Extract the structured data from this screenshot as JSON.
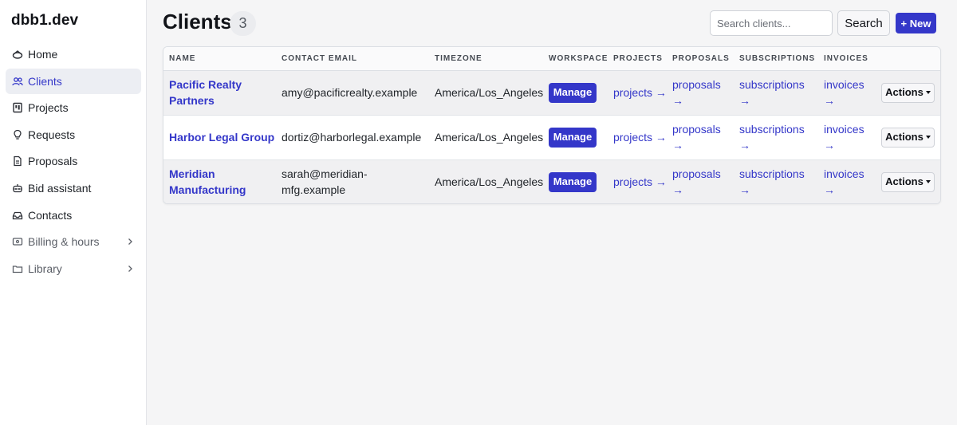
{
  "brand": "dbb1.dev",
  "sidebar": {
    "items": [
      {
        "label": "Home",
        "icon": "home-icon"
      },
      {
        "label": "Clients",
        "icon": "users-icon",
        "active": true
      },
      {
        "label": "Projects",
        "icon": "projects-icon"
      },
      {
        "label": "Requests",
        "icon": "lightbulb-icon"
      },
      {
        "label": "Proposals",
        "icon": "document-icon"
      },
      {
        "label": "Bid assistant",
        "icon": "robot-icon"
      },
      {
        "label": "Contacts",
        "icon": "inbox-icon"
      },
      {
        "label": "Billing & hours",
        "icon": "billing-icon",
        "expandable": true
      },
      {
        "label": "Library",
        "icon": "folder-icon",
        "expandable": true
      }
    ]
  },
  "header": {
    "title": "Clients",
    "count": "3",
    "search_placeholder": "Search clients...",
    "search_label": "Search",
    "new_label": "+ New"
  },
  "table": {
    "columns": [
      "Name",
      "Contact email",
      "Timezone",
      "Workspace",
      "Projects",
      "Proposals",
      "Subscriptions",
      "Invoices",
      ""
    ],
    "rows": [
      {
        "name": "Pacific Realty Partners",
        "email": "amy@pacificrealty.example",
        "timezone": "America/Los_Angeles",
        "workspace": "Manage",
        "projects": "projects →",
        "proposals": "proposals →",
        "subscriptions": "subscriptions →",
        "invoices": "invoices →",
        "actions": "Actions"
      },
      {
        "name": "Harbor Legal Group",
        "email": "dortiz@harborlegal.example",
        "timezone": "America/Los_Angeles",
        "workspace": "Manage",
        "projects": "projects →",
        "proposals": "proposals →",
        "subscriptions": "subscriptions →",
        "invoices": "invoices →",
        "actions": "Actions"
      },
      {
        "name": "Meridian Manufacturing",
        "email": "sarah@meridian-mfg.example",
        "timezone": "America/Los_Angeles",
        "workspace": "Manage",
        "projects": "projects →",
        "proposals": "proposals →",
        "subscriptions": "subscriptions →",
        "invoices": "invoices →",
        "actions": "Actions"
      }
    ]
  },
  "colors": {
    "accent": "#3437c9",
    "active_nav_bg": "#eceef3",
    "row_shade": "#f0f0f2"
  }
}
